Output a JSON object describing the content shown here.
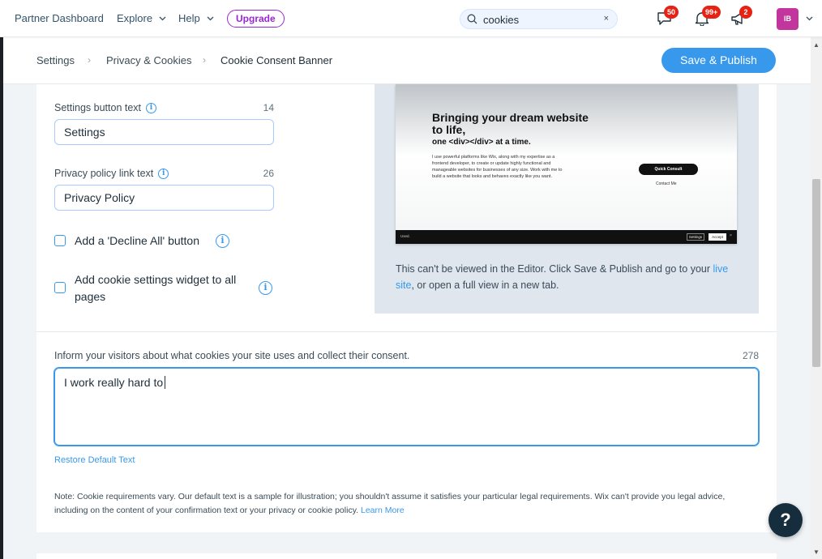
{
  "topbar": {
    "brand": "Partner Dashboard",
    "nav": [
      {
        "label": "Explore"
      },
      {
        "label": "Help"
      }
    ],
    "upgrade_label": "Upgrade",
    "search": {
      "value": "cookies",
      "clear": "×"
    },
    "icons": [
      {
        "name": "chat-icon",
        "badge": "50"
      },
      {
        "name": "bell-icon",
        "badge": "99+"
      },
      {
        "name": "megaphone-icon",
        "badge": "2"
      }
    ],
    "avatar_initials": "IB",
    "colors": {
      "accent": "#3899ec",
      "upgrade": "#9a27d5",
      "badge": "#e62214",
      "avatar": "#c2359c"
    }
  },
  "breadcrumb": {
    "items": [
      "Settings",
      "Privacy & Cookies",
      "Cookie Consent Banner"
    ],
    "separator": "›"
  },
  "publish_label": "Save & Publish",
  "form": {
    "settings_button": {
      "label": "Settings button text",
      "count": "14",
      "value": "Settings"
    },
    "privacy_link": {
      "label": "Privacy policy link text",
      "count": "26",
      "value": "Privacy Policy"
    },
    "decline_all": {
      "label": "Add a 'Decline All' button",
      "checked": false
    },
    "widget_all_pages": {
      "label": "Add cookie settings widget to all pages",
      "checked": false
    }
  },
  "preview": {
    "headline": "Bringing your dream website to life,",
    "subheadline": "one <div></div> at a time.",
    "paragraph": "I use powerful platforms like Wix, along with my expertise as a frontend developer, to create or update highly functional and manageable websites for businesses of any size. Work with me to build a website that looks and behaves exactly like you want.",
    "cta": "Quick Consult",
    "link": "Contact Me",
    "banner_text": "Used.",
    "banner_settings": "Settings",
    "banner_accept": "Accept",
    "banner_close": "×",
    "note_before": "This can't be viewed in the Editor. Click Save & Publish and go to your ",
    "note_link": "live site",
    "note_after": ", or open a full view in a new tab."
  },
  "consent": {
    "label": "Inform your visitors about what cookies your site uses and collect their consent.",
    "count": "278",
    "value": "I work really hard to",
    "restore_label": "Restore Default Text",
    "note": "Note: Cookie requirements vary. Our default text is a sample for illustration; you shouldn't assume it satisfies your particular legal requirements. Wix can't provide you legal advice, including on the content of your confirmation text or your privacy or cookie policy. ",
    "learn_more": "Learn More"
  },
  "help_label": "?"
}
